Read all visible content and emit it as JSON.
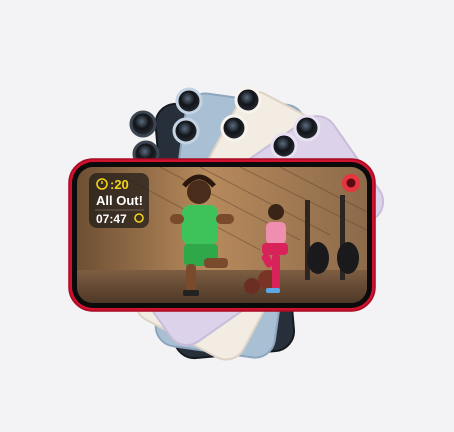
{
  "overlay": {
    "timer_value": ":20",
    "status_text": "All Out!",
    "elapsed_time": "07:47"
  },
  "colors": {
    "background": "#f3f3f5",
    "phone_red": "#d2112f",
    "phone_midnight": "#27303a",
    "phone_blue": "#a9bfd3",
    "phone_starlight": "#f3ece2",
    "phone_purple": "#dcd3ea",
    "timer_yellow": "#f2d21a",
    "record_red": "#e8343f"
  },
  "icons": [
    "stopwatch-icon",
    "activity-rings-icon",
    "record-icon"
  ]
}
